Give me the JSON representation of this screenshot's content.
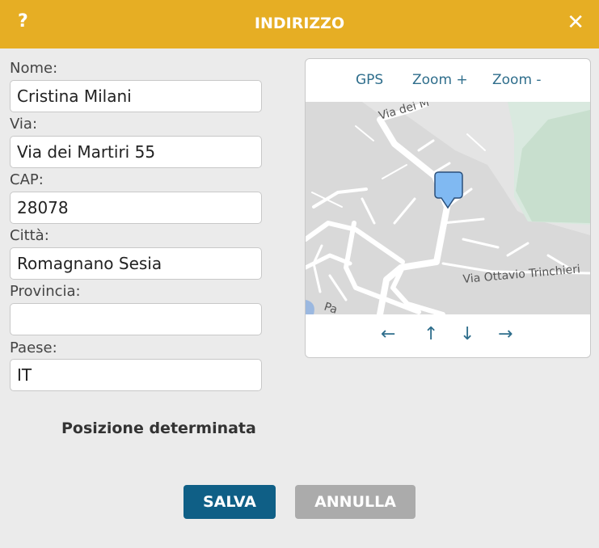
{
  "header": {
    "help_label": "?",
    "title": "INDIRIZZO",
    "close_label": "✕"
  },
  "form": {
    "name_label": "Nome:",
    "name_value": "Cristina Milani",
    "street_label": "Via:",
    "street_value": "Via dei Martiri 55",
    "zip_label": "CAP:",
    "zip_value": "28078",
    "city_label": "Città:",
    "city_value": "Romagnano Sesia",
    "province_label": "Provincia:",
    "province_value": "",
    "country_label": "Paese:",
    "country_value": "IT"
  },
  "map": {
    "gps_label": "GPS",
    "zoom_in_label": "Zoom +",
    "zoom_out_label": "Zoom -",
    "street_label_1": "Via dei M",
    "street_label_2": "Via Ottavio Trinchieri",
    "street_label_3": "Pa",
    "arrow_left": "←",
    "arrow_up": "↑",
    "arrow_down": "↓",
    "arrow_right": "→",
    "marker_color": "#80b9f2"
  },
  "status_text": "Posizione determinata",
  "buttons": {
    "save_label": "SALVA",
    "cancel_label": "ANNULLA"
  }
}
